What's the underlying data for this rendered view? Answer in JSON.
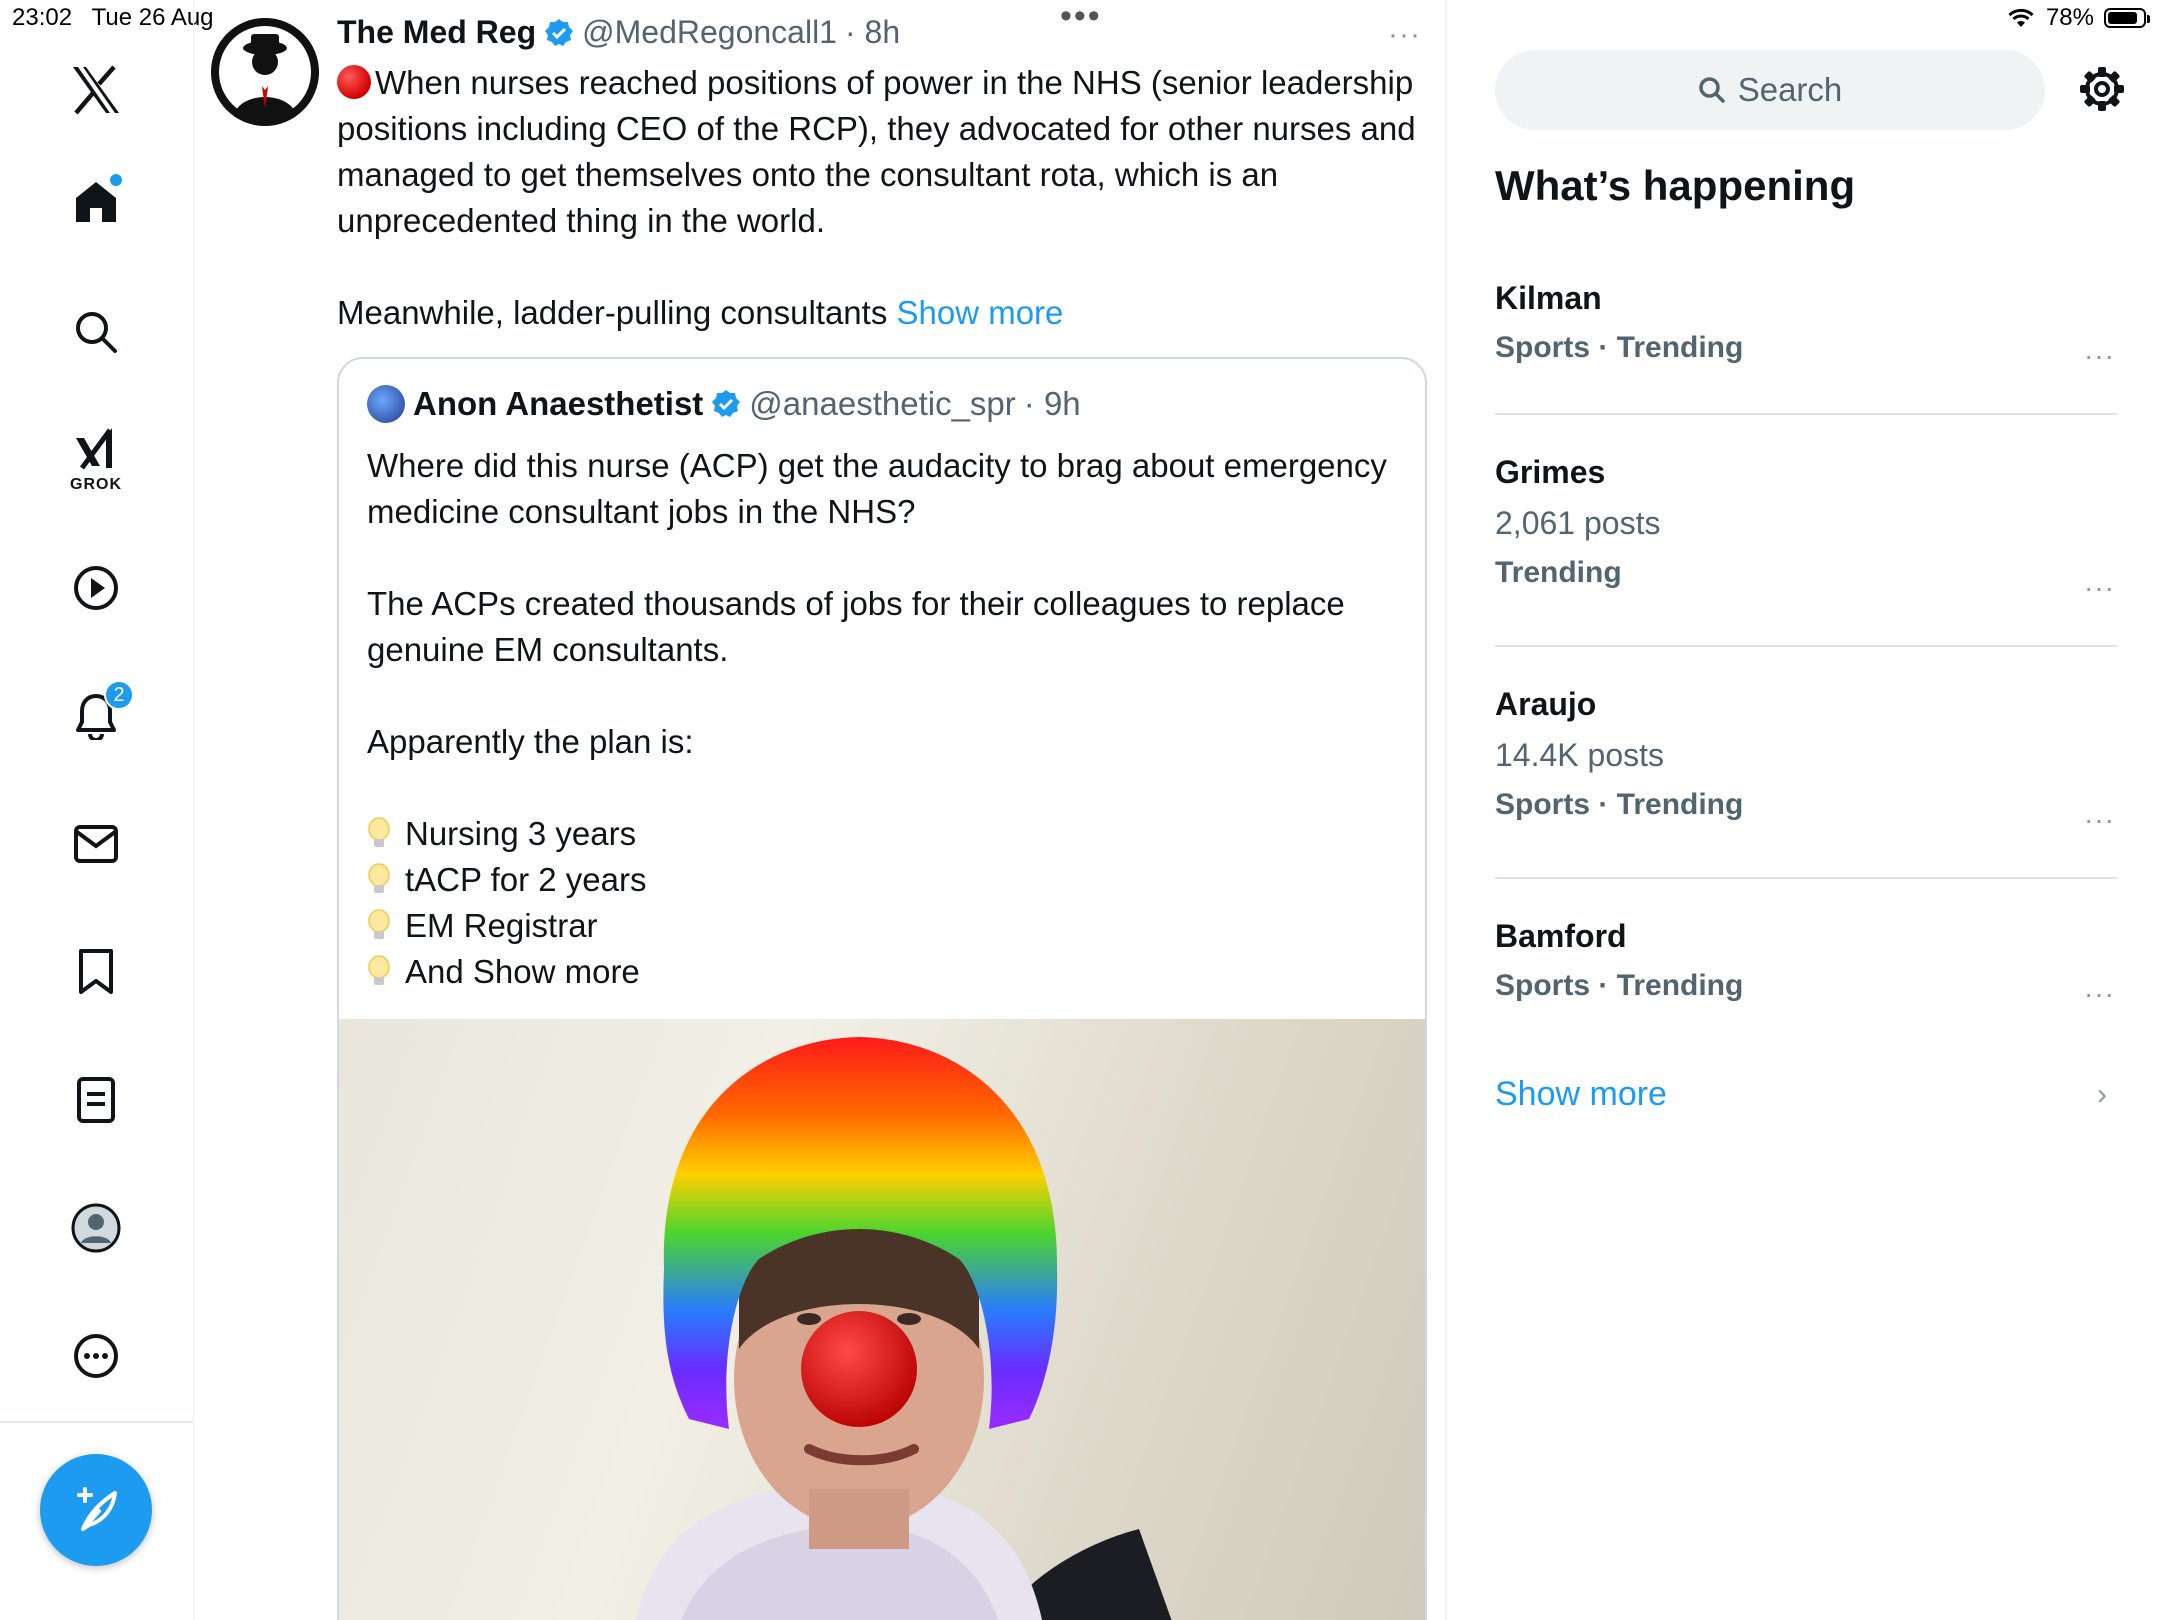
{
  "status_bar": {
    "time": "23:02",
    "date": "Tue 26 Aug",
    "battery": "78%",
    "battery_level": 0.78
  },
  "nav": {
    "grok_label": "GROK",
    "notifications_badge": "2"
  },
  "tweet": {
    "author": "The Med Reg",
    "handle": "@MedRegoncall1",
    "time": "· 8h",
    "more": "···",
    "text1": "When nurses reached positions of power in the NHS (senior leadership positions including CEO of the RCP), they advocated for other nurses and managed to get themselves onto the consultant rota, which is an unprecedented thing in the world.",
    "text2": "Meanwhile, ladder-pulling consultants",
    "show_more": "Show more"
  },
  "quote": {
    "author": "Anon Anaesthetist",
    "handle": "@anaesthetic_spr",
    "time": "· 9h",
    "p1": "Where did this nurse (ACP) get the audacity to brag about emergency medicine consultant jobs in the NHS?",
    "p2": "The ACPs created thousands of jobs for their colleagues to replace genuine EM consultants.",
    "p3": "Apparently the plan is:",
    "list": [
      "Nursing 3 years",
      "tACP for 2 years",
      "EM Registrar",
      "And Show more"
    ]
  },
  "sidebar": {
    "search_placeholder": "Search",
    "title": "What’s happening",
    "trends": [
      {
        "name": "Kilman",
        "meta": "Sports · Trending"
      },
      {
        "name": "Grimes",
        "posts": "2,061 posts",
        "meta": "Trending"
      },
      {
        "name": "Araujo",
        "posts": "14.4K posts",
        "meta": "Sports · Trending"
      },
      {
        "name": "Bamford",
        "meta": "Sports · Trending"
      }
    ],
    "trend_more": "···",
    "show_more": "Show more",
    "chevron": "›"
  },
  "colors": {
    "accent": "#1d9bf0",
    "text": "#0f1419",
    "secondary": "#536471"
  }
}
